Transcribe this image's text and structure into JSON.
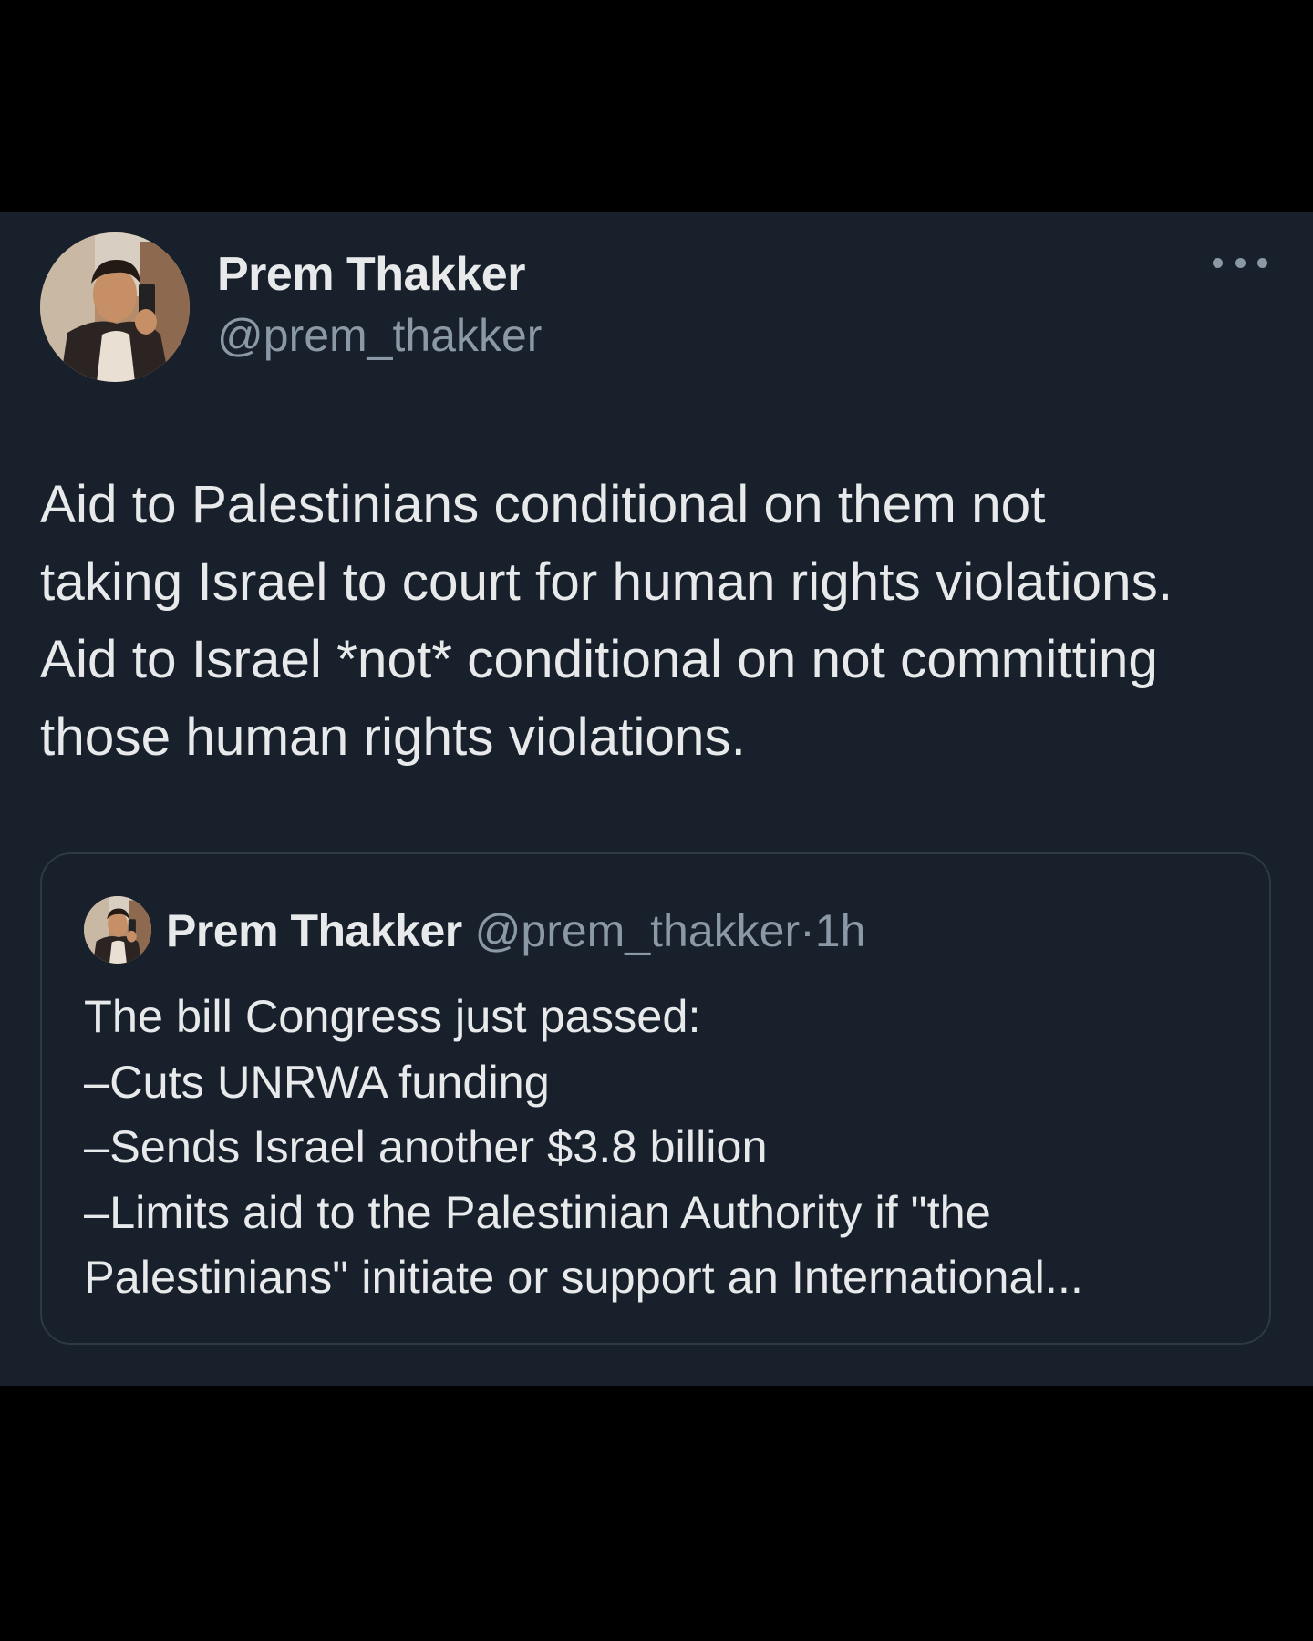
{
  "author": {
    "name": "Prem Thakker",
    "handle": "@prem_thakker",
    "avatar_icon": "profile-photo"
  },
  "more_icon": "more-horizontal-icon",
  "tweet": {
    "text": "Aid to Palestinians conditional on them not\ntaking Israel to court for human rights violations.\nAid to Israel *not* conditional on not committing\nthose human rights violations."
  },
  "quote": {
    "author_name": "Prem Thakker",
    "author_handle": "@prem_thakker",
    "separator": "·",
    "time": "1h",
    "text": "The bill Congress just passed:\n–Cuts UNRWA funding\n–Sends Israel another $3.8 billion\n–Limits aid to the Palestinian Authority if \"the\nPalestinians\" initiate or support an International..."
  },
  "colors": {
    "page_background": "#000000",
    "card_background": "#17202b",
    "primary_text": "#e7e9ea",
    "secondary_text": "#8b98a5",
    "quote_border": "#2f3945"
  }
}
